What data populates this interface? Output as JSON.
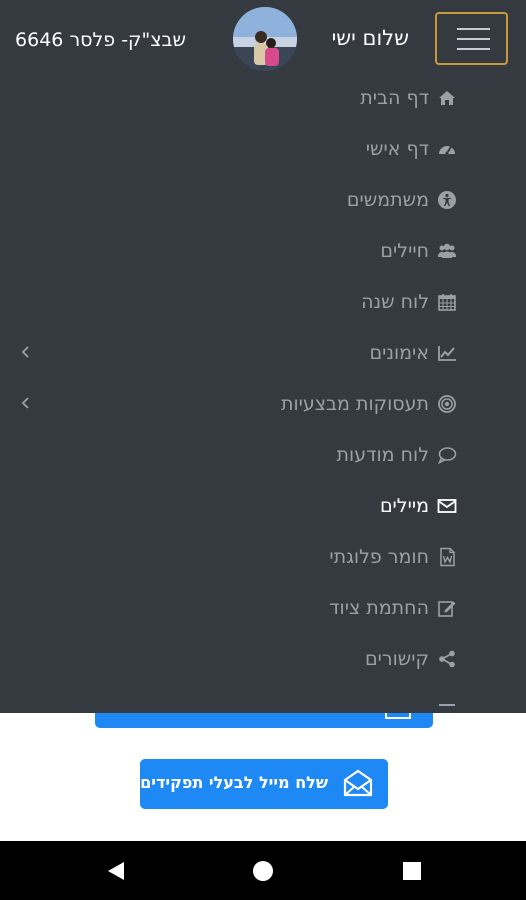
{
  "header": {
    "greeting": "שלום ישי",
    "unit": "שבצ\"ק- פלסר 6646",
    "menu_button_icon": "hamburger-icon",
    "colors": {
      "background": "#343a40",
      "menu_button_border": "#c69a3a"
    }
  },
  "menu": {
    "items": [
      {
        "label": "דף הבית",
        "icon": "home-icon"
      },
      {
        "label": "דף אישי",
        "icon": "dashboard-icon"
      },
      {
        "label": "משתמשים",
        "icon": "accessibility-icon"
      },
      {
        "label": "חיילים",
        "icon": "users-icon"
      },
      {
        "label": "לוח שנה",
        "icon": "calendar-icon"
      },
      {
        "label": "אימונים",
        "icon": "chart-line-icon",
        "has_submenu": true
      },
      {
        "label": "תעסוקות מבצעיות",
        "icon": "target-icon",
        "has_submenu": true
      },
      {
        "label": "לוח מודעות",
        "icon": "comment-icon"
      },
      {
        "label": "מיילים",
        "icon": "envelope-icon",
        "active": true
      },
      {
        "label": "חומר פלוגתי",
        "icon": "word-file-icon"
      },
      {
        "label": "החתמת ציוד",
        "icon": "edit-icon"
      },
      {
        "label": "קישורים",
        "icon": "share-icon"
      }
    ]
  },
  "main": {
    "send_button": {
      "label": "שלח מייל לבעלי תפקידים",
      "icon": "open-envelope-icon"
    },
    "colors": {
      "button": "#1e88f5"
    }
  },
  "system_nav": {
    "back_icon": "back-triangle-icon",
    "home_icon": "home-circle-icon",
    "recents_icon": "recents-square-icon"
  }
}
